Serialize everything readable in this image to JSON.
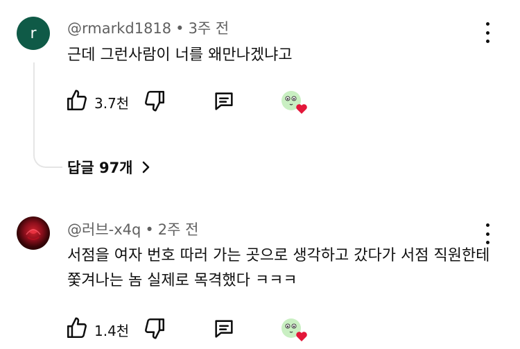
{
  "comments": [
    {
      "author": "@rmarkd1818",
      "dot": "•",
      "time": "3주 전",
      "avatar_letter": "r",
      "text": "근데 그런사람이 너를 왜만나겠냐고",
      "likes": "3.7천",
      "replies_label": "답글 97개"
    },
    {
      "author": "@러브-x4q",
      "dot": "•",
      "time": "2주 전",
      "text": "서점을 여자 번호 따러 가는 곳으로 생각하고 갔다가 서점 직원한테 쫓겨나는 놈 실제로 목격했다 ㅋㅋㅋ",
      "likes": "1.4천"
    }
  ],
  "icons": {
    "like": "thumbs-up-icon",
    "dislike": "thumbs-down-icon",
    "reply": "reply-comment-icon",
    "creator_heart": "creator-heart-badge",
    "more": "more-vertical-icon",
    "chevron": "chevron-right-icon"
  },
  "colors": {
    "heart": "#e3173a",
    "avatar_r": "#0f5a47",
    "meta": "#606060"
  }
}
